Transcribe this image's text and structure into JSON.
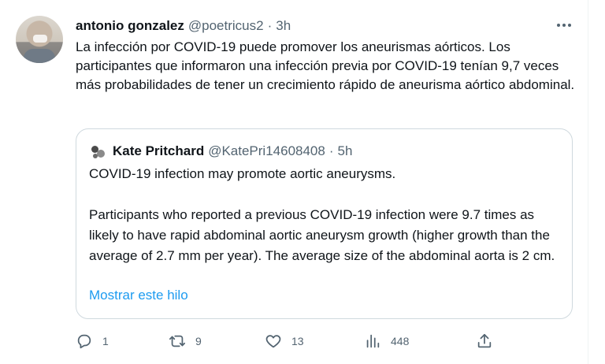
{
  "tweet": {
    "display_name": "antonio gonzalez",
    "handle": "@poetricus2",
    "separator": "·",
    "time": "3h",
    "more_icon": "more-horizontal-icon",
    "text": "La infección por COVID-19 puede promover los aneurismas aórticos. Los participantes que informaron una infección previa por COVID-19 tenían 9,7 veces más probabilidades de tener un crecimiento rápido de aneurisma aórtico abdominal."
  },
  "quote": {
    "display_name": "Kate Pritchard",
    "handle": "@KatePri14608408",
    "separator": "·",
    "time": "5h",
    "paragraphs": [
      "COVID-19 infection may promote aortic aneurysms.",
      "Participants who reported a previous COVID-19 infection were 9.7 times as likely to have rapid abdominal aortic aneurysm growth (higher growth than the average of 2.7 mm per year). The average size of the abdominal aorta is 2 cm."
    ],
    "show_thread": "Mostrar este hilo"
  },
  "actions": {
    "reply": {
      "icon": "reply-icon",
      "count": "1"
    },
    "retweet": {
      "icon": "retweet-icon",
      "count": "9"
    },
    "like": {
      "icon": "heart-icon",
      "count": "13"
    },
    "views": {
      "icon": "views-icon",
      "count": "448"
    },
    "share": {
      "icon": "share-icon",
      "count": ""
    }
  },
  "colors": {
    "text": "#0f1419",
    "secondary": "#536471",
    "link": "#1d9bf0",
    "border": "#cfd9de"
  }
}
